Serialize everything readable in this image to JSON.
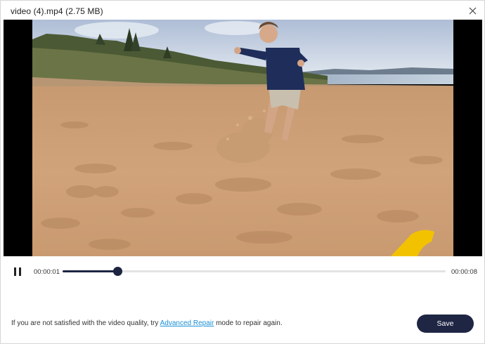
{
  "window": {
    "title": "video (4).mp4 (2.75  MB)"
  },
  "player": {
    "current_time": "00:00:01",
    "total_time": "00:00:08",
    "progress_fraction": 0.143,
    "play_state": "playing",
    "pause_icon": "pause-icon"
  },
  "footer": {
    "note_prefix": "If you are not satisfied with the video quality, try ",
    "link_label": "Advanced Repair",
    "note_suffix": " mode to repair again.",
    "save_label": "Save"
  },
  "colors": {
    "accent": "#1f2644",
    "link": "#1a8fd6",
    "track": "#e3e3e3"
  }
}
